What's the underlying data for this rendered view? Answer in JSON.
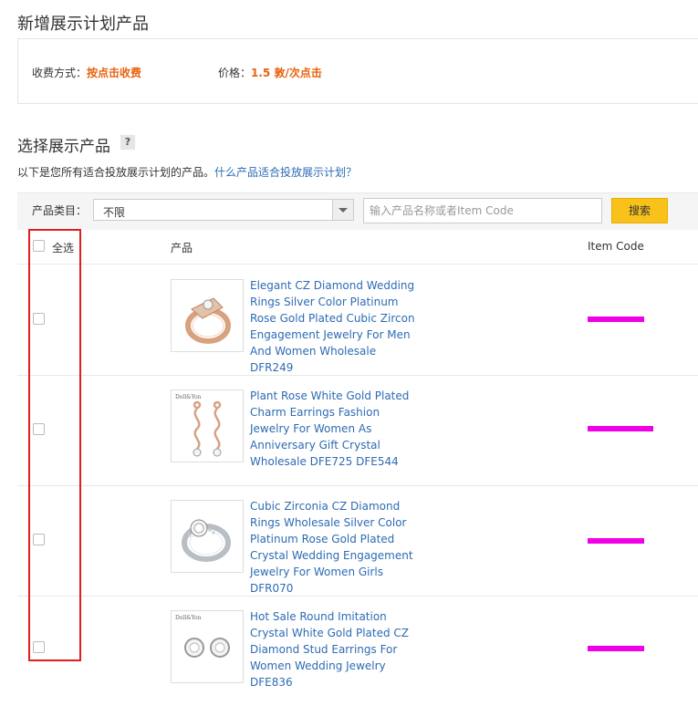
{
  "page_title": "新增展示计划产品",
  "charge": {
    "method_label": "收费方式：",
    "method_value": "按点击收费",
    "price_label": "价格：",
    "price_value": "1.5 敦/次点击"
  },
  "section": {
    "title": "选择展示产品",
    "help": "?",
    "intro_text": "以下是您所有适合投放展示计划的产品。",
    "intro_link": "什么产品适合投放展示计划？"
  },
  "filter": {
    "category_label": "产品类目：",
    "category_value": "不限",
    "search_placeholder": "输入产品名称或者Item Code",
    "search_button": "搜索"
  },
  "table": {
    "select_all": "全选",
    "col_product": "产品",
    "col_item_code": "Item Code"
  },
  "products": [
    {
      "title": "Elegant CZ Diamond Wedding Rings Silver Color Platinum Rose Gold Plated Cubic Zircon Engagement Jewelry For Men And Women Wholesale DFR249",
      "image": "rose-gold-ring"
    },
    {
      "title": "Plant Rose White Gold Plated Charm Earrings Fashion Jewelry For Women As Anniversary Gift Crystal Wholesale DFE725 DFE544",
      "image": "drop-earrings"
    },
    {
      "title": "Cubic Zirconia CZ Diamond Rings Wholesale Silver Color Platinum Rose Gold Plated Crystal Wedding Engagement Jewelry For Women Girls DFR070",
      "image": "silver-ring"
    },
    {
      "title": "Hot Sale Round Imitation Crystal White Gold Plated CZ Diamond Stud Earrings For Women Wedding Jewelry DFE836",
      "image": "stud-earrings"
    }
  ],
  "colors": {
    "accent_orange": "#e8620d",
    "link_blue": "#2d6bb3",
    "search_yellow": "#f8c21b",
    "highlight_red": "#e02020",
    "redaction_magenta": "#f000e6"
  }
}
